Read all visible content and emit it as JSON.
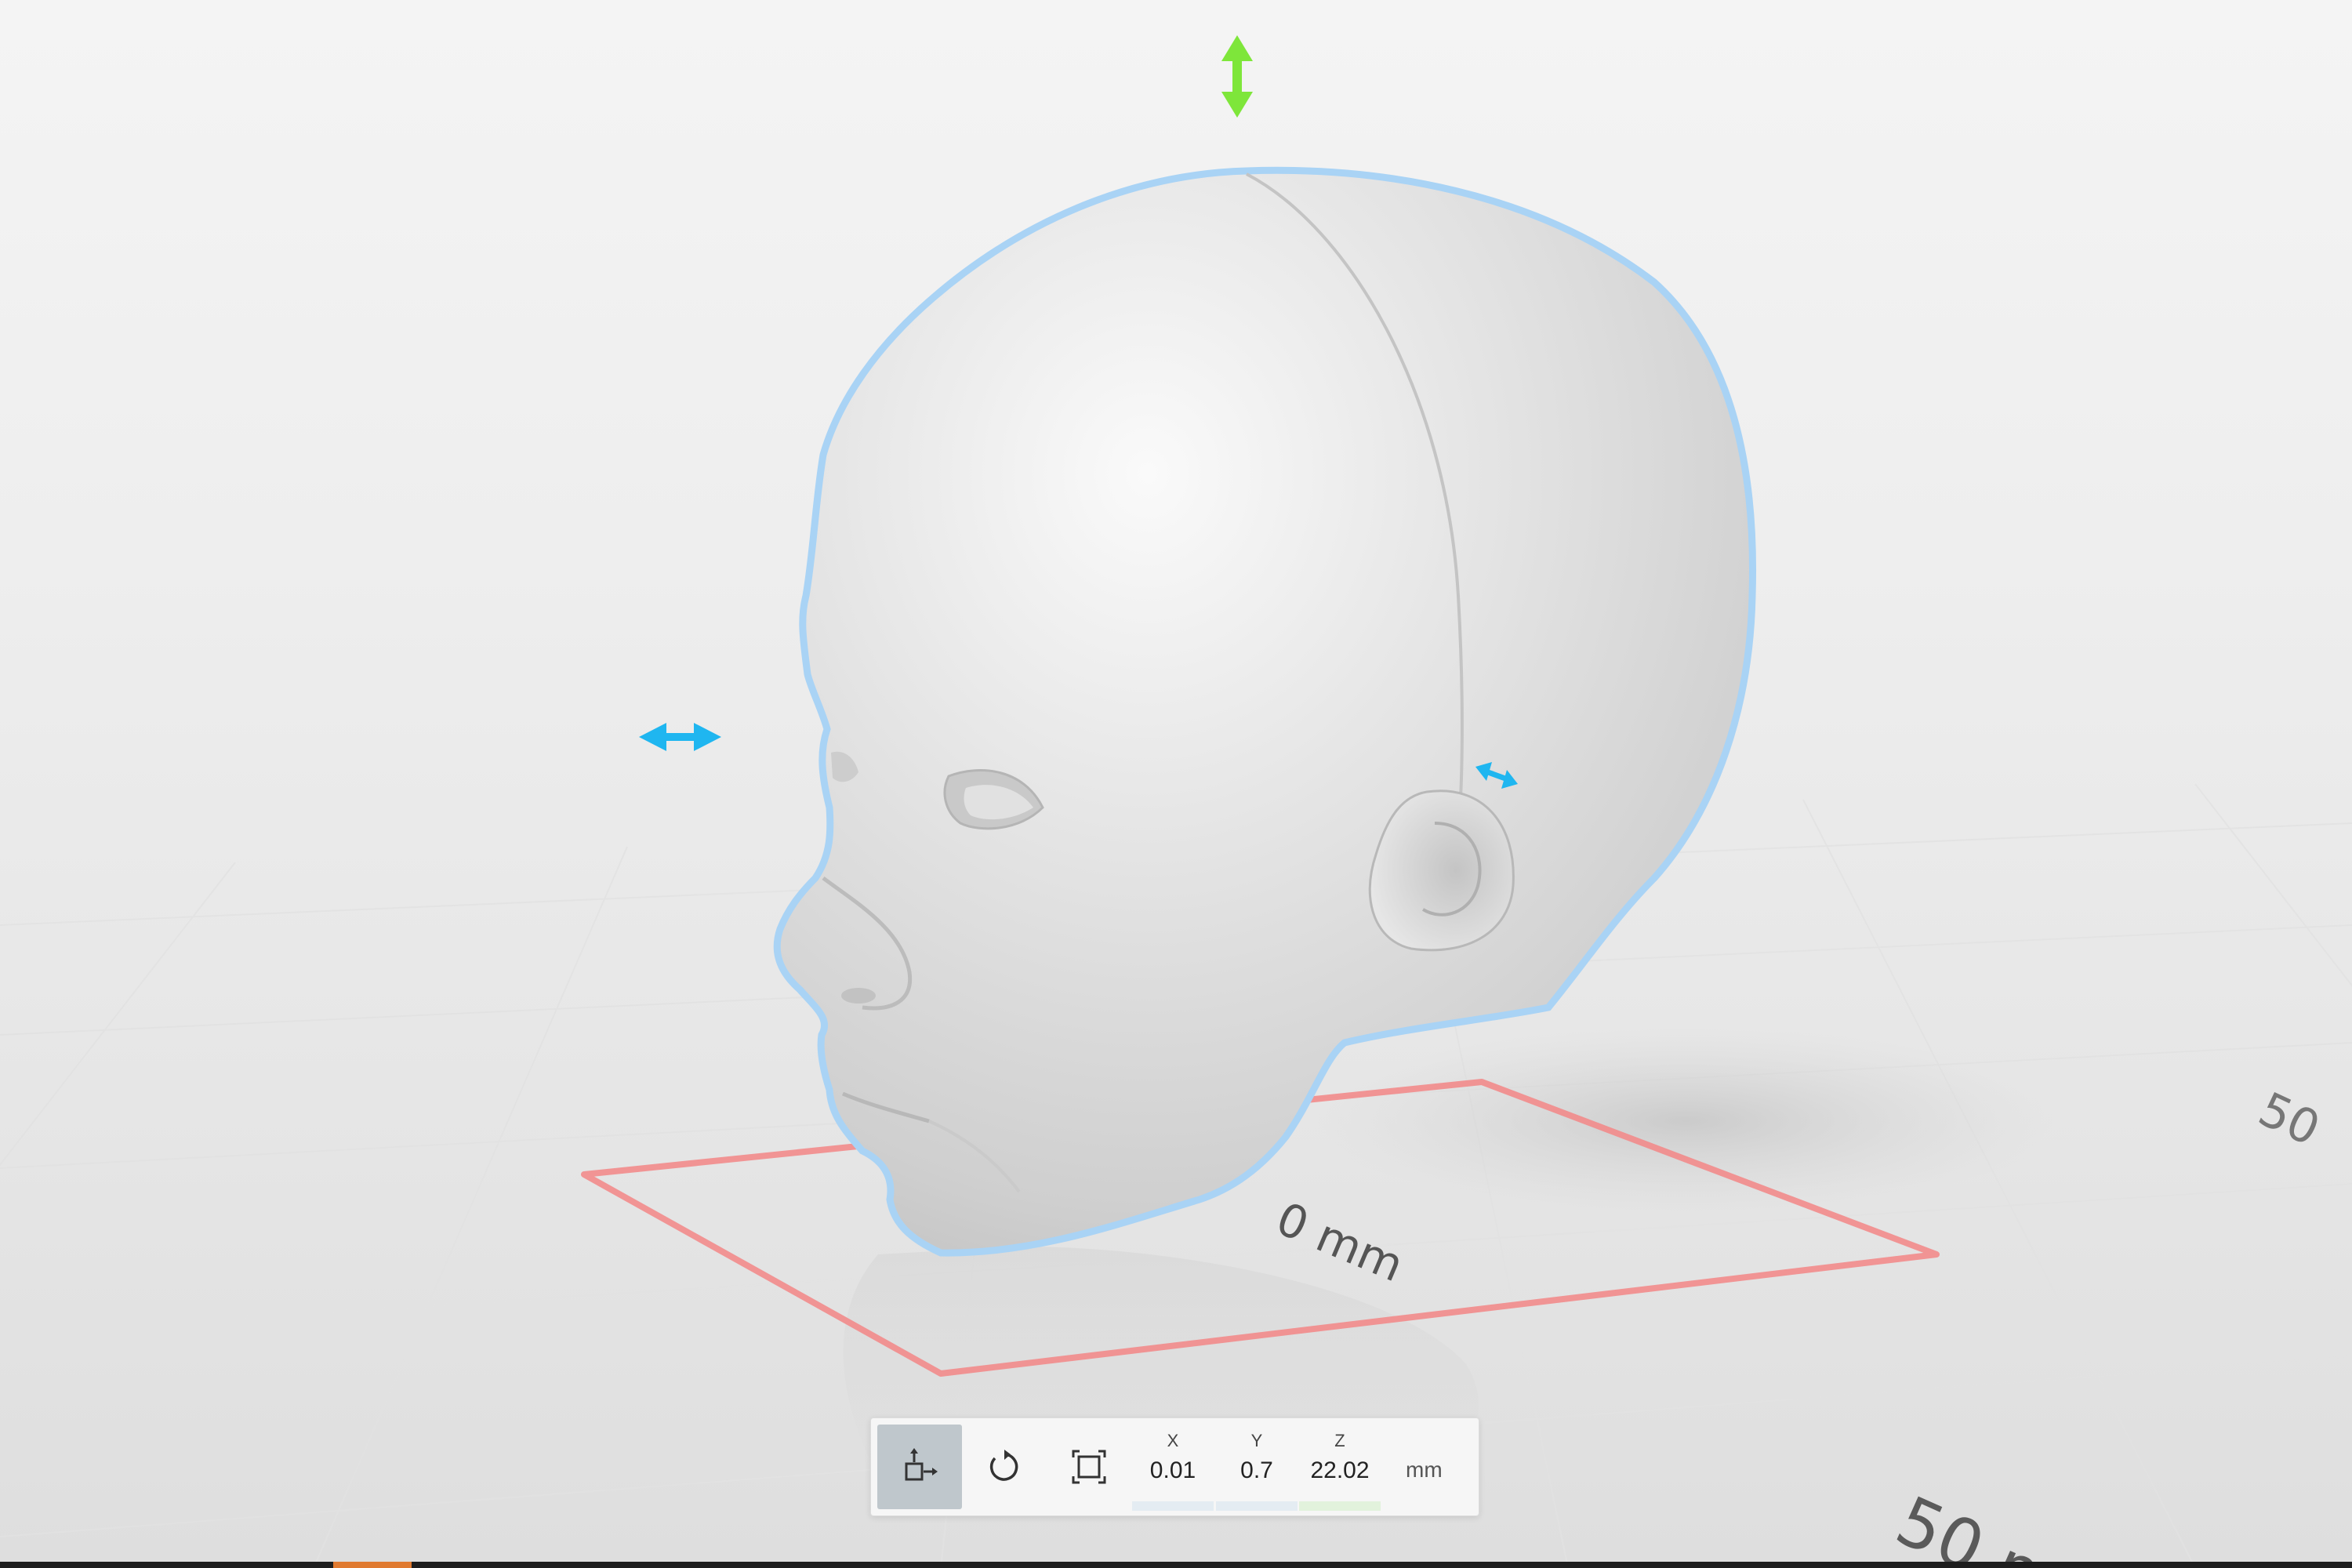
{
  "viewport": {
    "grid_labels": {
      "origin": "0 mm",
      "fifty_bottom": "50 m",
      "fifty_right": "50"
    }
  },
  "colors": {
    "selection_outline": "#a9d3f5",
    "height_handle": "#7ee63a",
    "width_handle": "#1fb6f0",
    "footprint": "#f28b8b",
    "active_tool": "#bfc7cc"
  },
  "toolbar": {
    "tools": [
      {
        "name": "move",
        "icon": "move-icon",
        "active": true
      },
      {
        "name": "rotate",
        "icon": "rotate-icon",
        "active": false
      },
      {
        "name": "scale",
        "icon": "scale-icon",
        "active": false
      }
    ],
    "position": {
      "x_label": "X",
      "x_value": "0.01",
      "y_label": "Y",
      "y_value": "0.7",
      "z_label": "Z",
      "z_value": "22.02"
    },
    "unit": "mm"
  }
}
